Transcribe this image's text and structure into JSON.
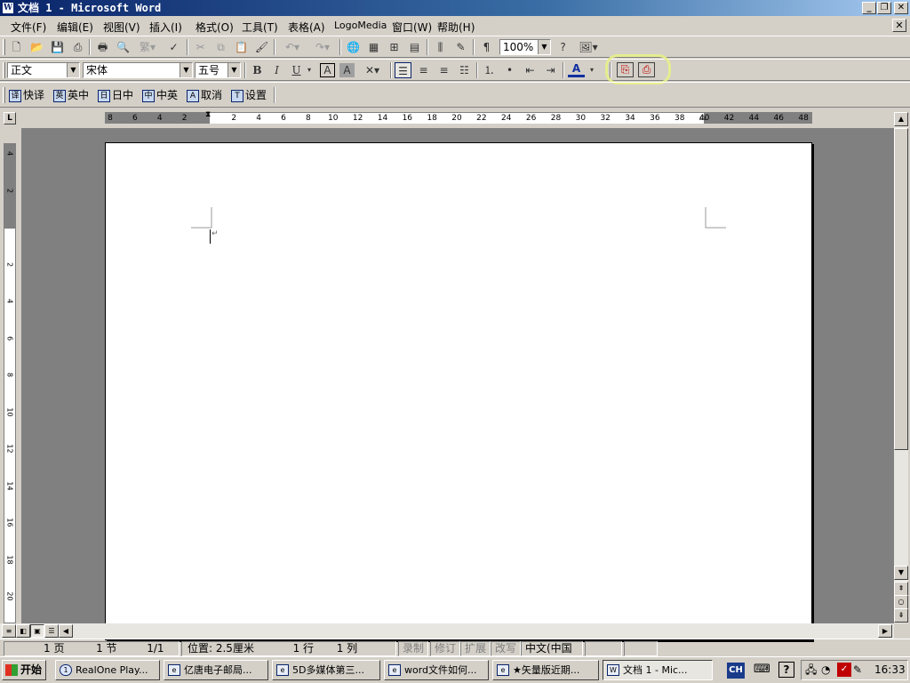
{
  "window": {
    "title": "文档 1 - Microsoft Word",
    "app_icon": "word-icon",
    "controls": {
      "minimize": "_",
      "restore": "❐",
      "close": "✕"
    }
  },
  "menubar": {
    "items": [
      "文件(F)",
      "编辑(E)",
      "视图(V)",
      "插入(I)",
      "格式(O)",
      "工具(T)",
      "表格(A)",
      "LogoMedia",
      "窗口(W)",
      "帮助(H)"
    ],
    "close_doc": "✕"
  },
  "standard_toolbar": {
    "zoom": "100%",
    "icons": [
      "new-icon",
      "open-icon",
      "save-icon",
      "permission-icon",
      "print-icon",
      "print-preview-icon",
      "spelling-icon",
      "research-icon",
      "cut-icon",
      "copy-icon",
      "paste-icon",
      "format-painter-icon",
      "undo-icon",
      "redo-icon",
      "hyperlink-icon",
      "tables-borders-icon",
      "insert-table-icon",
      "insert-excel-icon",
      "columns-icon",
      "drawing-icon",
      "show-hide-icon",
      "help-icon",
      "read-icon"
    ]
  },
  "formatting_toolbar": {
    "style": "正文",
    "font": "宋体",
    "size": "五号",
    "bold": "B",
    "italic": "I",
    "underline": "U",
    "char_border": "A",
    "char_shading": "A",
    "font_color": "A"
  },
  "translate_toolbar": {
    "items": [
      {
        "icon": "译",
        "label": "快译"
      },
      {
        "icon": "英",
        "label": "英中"
      },
      {
        "icon": "日",
        "label": "日中"
      },
      {
        "icon": "中",
        "label": "中英"
      },
      {
        "icon": "A",
        "label": "取消"
      },
      {
        "icon": "T",
        "label": "设置"
      }
    ]
  },
  "ruler": {
    "tab_selector": "L",
    "h_numbers": [
      "8",
      "6",
      "4",
      "2",
      "",
      "2",
      "4",
      "6",
      "8",
      "10",
      "12",
      "14",
      "16",
      "18",
      "20",
      "22",
      "24",
      "26",
      "28",
      "30",
      "32",
      "34",
      "36",
      "38",
      "40",
      "42",
      "44",
      "46",
      "48"
    ],
    "v_numbers": [
      "4",
      "2",
      "",
      "2",
      "4",
      "6",
      "8",
      "10",
      "12",
      "14",
      "16",
      "18",
      "20"
    ]
  },
  "statusbar": {
    "page": "1 页",
    "section": "1 节",
    "page_of": "1/1",
    "position": "位置: 2.5厘米",
    "line": "1 行",
    "column": "1 列",
    "rec": "录制",
    "trk": "修订",
    "ext": "扩展",
    "ovr": "改写",
    "language": "中文(中国"
  },
  "taskbar": {
    "start": "开始",
    "tasks": [
      {
        "label": "RealOne Play...",
        "icon": "realone-icon"
      },
      {
        "label": "亿唐电子邮局...",
        "icon": "ie-icon"
      },
      {
        "label": "5D多媒体第三...",
        "icon": "ie-icon"
      },
      {
        "label": "word文件如何...",
        "icon": "ie-icon"
      },
      {
        "label": "★矢量版近期...",
        "icon": "ie-icon"
      },
      {
        "label": "文档 1 - Mic...",
        "icon": "word-icon"
      }
    ],
    "ime": "CH",
    "clock": "16:33"
  }
}
